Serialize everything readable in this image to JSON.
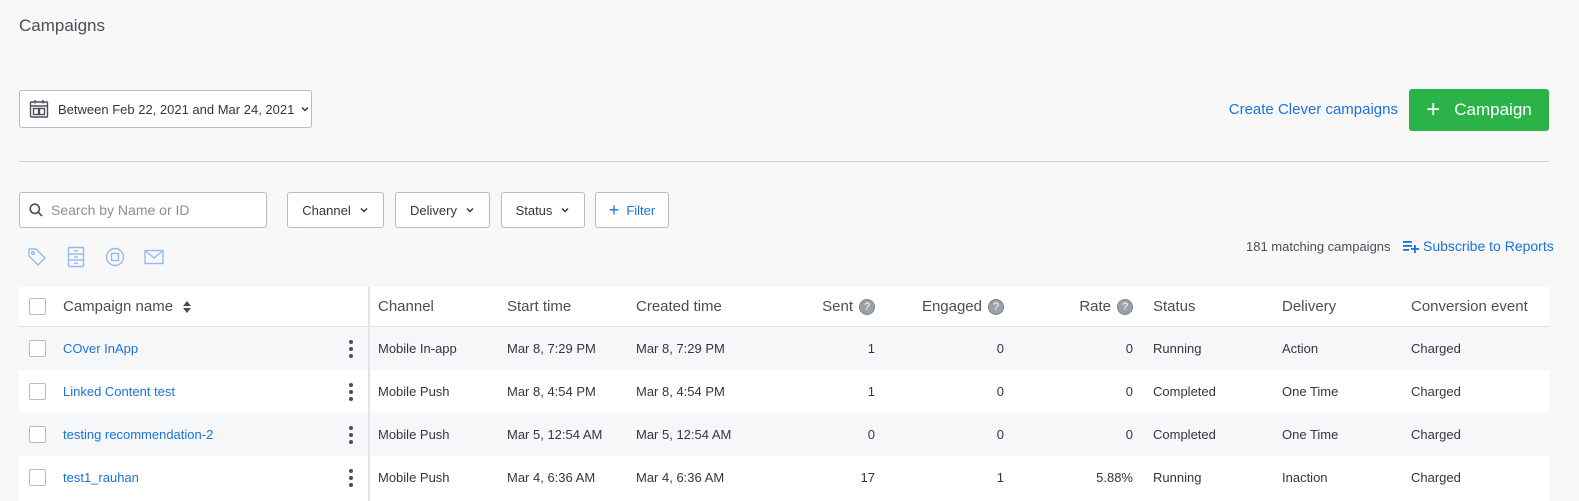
{
  "page": {
    "title": "Campaigns"
  },
  "date_range": {
    "label": "Between Feb 22, 2021 and Mar 24, 2021"
  },
  "actions": {
    "clever_link": "Create Clever campaigns",
    "campaign_button": "Campaign"
  },
  "search": {
    "placeholder": "Search by Name or ID",
    "value": ""
  },
  "filters": {
    "channel": "Channel",
    "delivery": "Delivery",
    "status": "Status",
    "filter": "Filter"
  },
  "summary": {
    "matching": "181 matching campaigns",
    "subscribe": "Subscribe to Reports"
  },
  "table": {
    "headers": {
      "name": "Campaign name",
      "channel": "Channel",
      "start": "Start time",
      "created": "Created time",
      "sent": "Sent",
      "engaged": "Engaged",
      "rate": "Rate",
      "status": "Status",
      "delivery": "Delivery",
      "conversion": "Conversion event"
    },
    "help_glyph": "?",
    "rows": [
      {
        "name": "COver InApp",
        "channel": "Mobile In-app",
        "start": "Mar 8, 7:29 PM",
        "created": "Mar 8, 7:29 PM",
        "sent": "1",
        "engaged": "0",
        "rate": "0",
        "status": "Running",
        "delivery": "Action",
        "conversion": "Charged"
      },
      {
        "name": "Linked Content test",
        "channel": "Mobile Push",
        "start": "Mar 8, 4:54 PM",
        "created": "Mar 8, 4:54 PM",
        "sent": "1",
        "engaged": "0",
        "rate": "0",
        "status": "Completed",
        "delivery": "One Time",
        "conversion": "Charged"
      },
      {
        "name": "testing recommendation-2",
        "channel": "Mobile Push",
        "start": "Mar 5, 12:54 AM",
        "created": "Mar 5, 12:54 AM",
        "sent": "0",
        "engaged": "0",
        "rate": "0",
        "status": "Completed",
        "delivery": "One Time",
        "conversion": "Charged"
      },
      {
        "name": "test1_rauhan",
        "channel": "Mobile Push",
        "start": "Mar 4, 6:36 AM",
        "created": "Mar 4, 6:36 AM",
        "sent": "17",
        "engaged": "1",
        "rate": "5.88%",
        "status": "Running",
        "delivery": "Inaction",
        "conversion": "Charged"
      }
    ]
  },
  "icons": {
    "calendar": "calendar-icon",
    "chevron": "chevron-down-icon",
    "search": "search-icon",
    "tag": "tag-icon",
    "archive": "archive-icon",
    "stop": "stop-icon",
    "mail": "mail-icon",
    "subscribe": "playlist-add-icon",
    "sort": "sort-icon",
    "kebab": "more-vertical-icon",
    "help": "help-icon"
  },
  "colors": {
    "accent": "#1a73d9",
    "primary_button": "#2bb34a"
  }
}
